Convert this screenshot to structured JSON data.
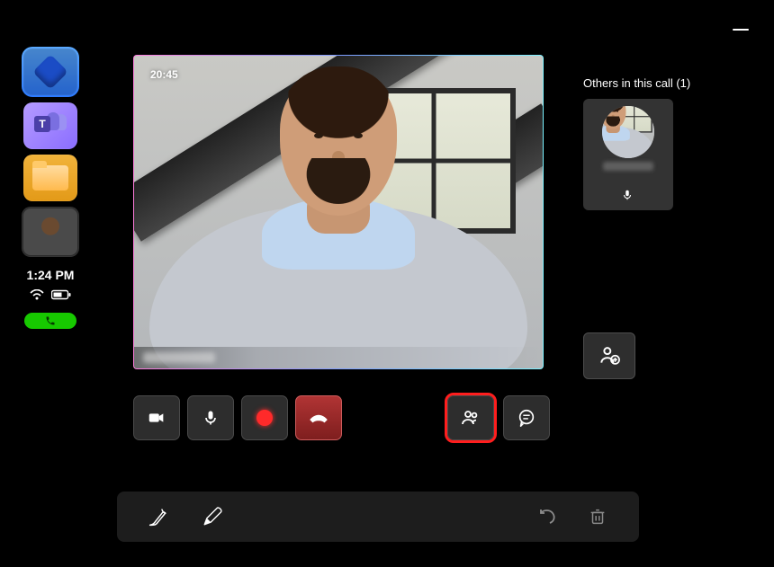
{
  "window": {
    "minimize": "—"
  },
  "rail": {
    "time": "1:24 PM",
    "teams_badge": "T",
    "items": [
      {
        "name": "home"
      },
      {
        "name": "teams"
      },
      {
        "name": "files"
      },
      {
        "name": "contact"
      }
    ]
  },
  "video": {
    "duration": "20:45",
    "participant_name": "Participant"
  },
  "others": {
    "title": "Others in this call (1)",
    "count": 1,
    "items": [
      {
        "name": "Participant",
        "muted": false
      }
    ]
  },
  "controls": {
    "camera": {
      "label": "Camera",
      "on": true
    },
    "mic": {
      "label": "Microphone",
      "on": true
    },
    "record": {
      "label": "Record",
      "on": true
    },
    "hangup": {
      "label": "Hang up"
    },
    "people": {
      "label": "Participants",
      "highlighted": true
    },
    "chat": {
      "label": "Chat"
    },
    "add_person": {
      "label": "Add person"
    }
  },
  "toolbar": {
    "pen": {
      "label": "Pen"
    },
    "pencil": {
      "label": "Pencil"
    },
    "undo": {
      "label": "Undo"
    },
    "delete": {
      "label": "Delete"
    }
  }
}
